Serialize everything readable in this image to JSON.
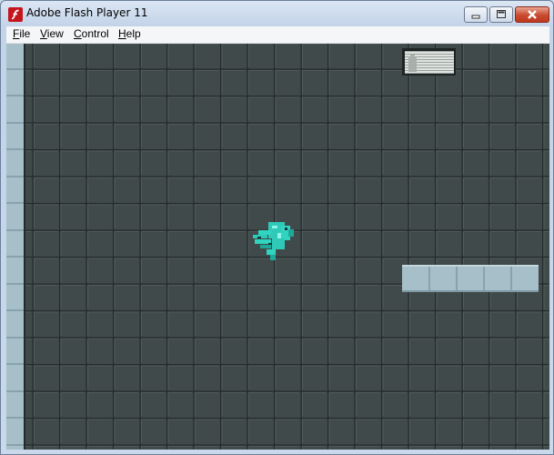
{
  "window": {
    "title": "Adobe Flash Player 11",
    "app_icon": "flash-player-icon",
    "controls": [
      "minimize-icon",
      "maximize-icon",
      "close-icon"
    ]
  },
  "menu": {
    "items": [
      "File",
      "View",
      "Control",
      "Help"
    ]
  },
  "game": {
    "background_color": "#404a4a",
    "grid_line_color": "#252b2c",
    "wall_color": "#a6bfc9",
    "player_color": "#31d4c0",
    "player": "player-character-sprite",
    "hud_panel": "striped-panel"
  }
}
